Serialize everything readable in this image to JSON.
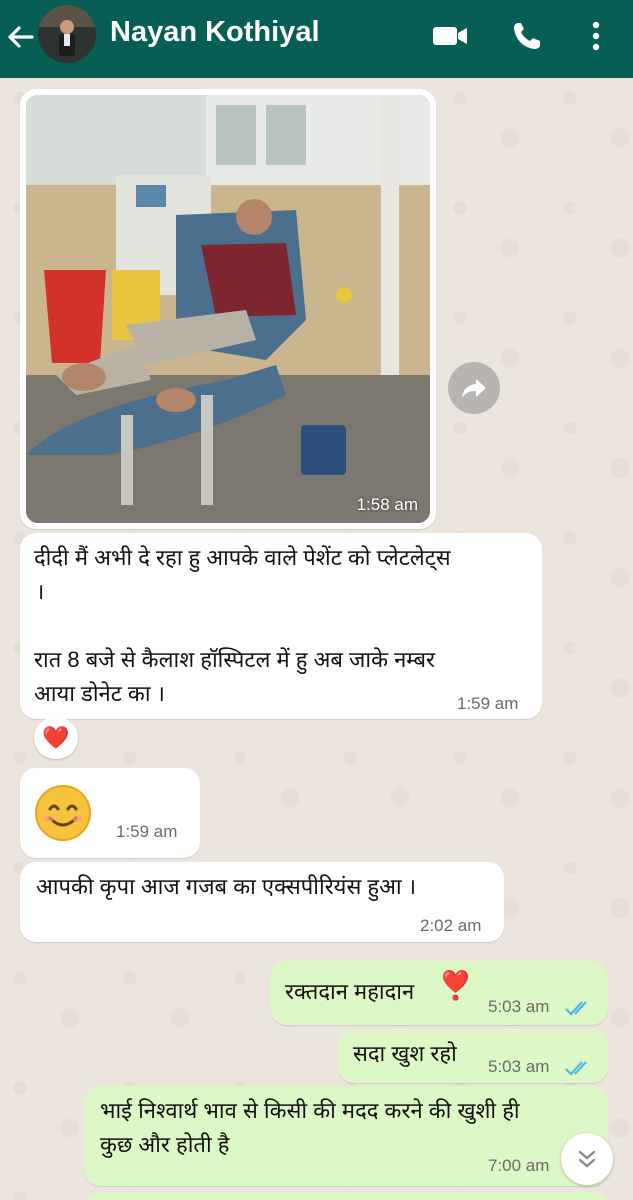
{
  "header": {
    "contact_name": "Nayan Kothiyal",
    "icons": [
      "back-arrow-icon",
      "video-call-icon",
      "voice-call-icon",
      "more-options-icon"
    ],
    "background_color": "#075e54"
  },
  "messages": [
    {
      "direction": "incoming",
      "type": "image",
      "time": "1:58 am"
    },
    {
      "direction": "incoming",
      "line1": "दीदी मैं अभी दे रहा हु आपके वाले पेशेंट को प्लेटलेट्स",
      "line2": "।",
      "line3": "रात 8 बजे से कैलाश हॉस्पिटल में हु अब जाके नम्बर",
      "line4": "आया डोनेट का ।",
      "time": "1:59 am",
      "reaction": "❤️"
    },
    {
      "direction": "incoming",
      "emoji": "😊",
      "time": "1:59 am"
    },
    {
      "direction": "incoming",
      "text": "आपकी कृपा आज गजब का  एक्सपीरियंस हुआ ।",
      "time": "2:02 am"
    },
    {
      "direction": "outgoing",
      "text": "रक्तदान महादान",
      "emoji": "❣️",
      "time": "5:03 am",
      "status": "read"
    },
    {
      "direction": "outgoing",
      "text": "सदा खुश रहो",
      "time": "5:03 am",
      "status": "read"
    },
    {
      "direction": "outgoing",
      "line1": "भाई निश्वार्थ भाव से किसी की मदद करने की खुशी ही",
      "line2": "कुछ और होती है",
      "time": "7:00 am"
    }
  ],
  "colors": {
    "incoming_bubble": "#ffffff",
    "outgoing_bubble": "#dcf8c6",
    "read_ticks": "#4fb6ec",
    "chat_background": "#ece5dd"
  }
}
